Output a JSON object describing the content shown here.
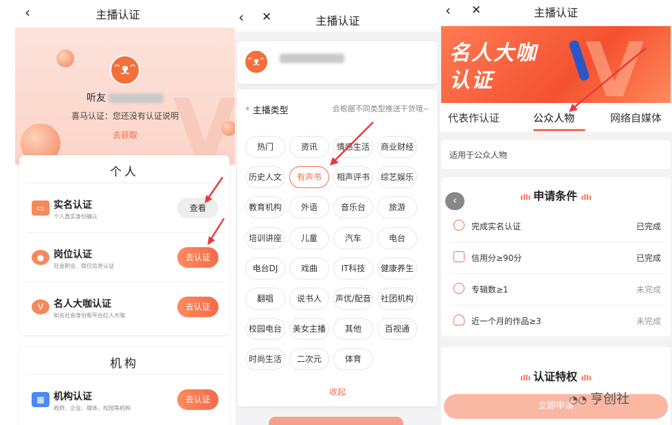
{
  "screen1": {
    "nav": {
      "back": "‹",
      "title": "主播认证"
    },
    "profile": {
      "name": "听友",
      "note": "喜马认证：您还没有认证说明",
      "link": "去获取"
    },
    "personal": {
      "title": "个人",
      "items": [
        {
          "label": "实名认证",
          "sub": "个人真实身份确认",
          "action": "查看"
        },
        {
          "label": "岗位认证",
          "sub": "社会职业、岗位信息认证",
          "action": "去认证"
        },
        {
          "label": "名人大咖认证",
          "sub": "知名社会身份和平台红人大咖",
          "action": "去认证"
        }
      ]
    },
    "org": {
      "title": "机构",
      "items": [
        {
          "label": "机构认证",
          "sub": "政府、企业、媒体、校园等机构",
          "action": "去认证"
        }
      ]
    }
  },
  "screen2": {
    "nav": {
      "back": "‹",
      "close": "✕",
      "title": "主播认证"
    },
    "type_label": "主播类型",
    "required_mark": "*",
    "type_hint": "会根据不同类型推送干货哦~",
    "categories": [
      "热门",
      "资讯",
      "情感生活",
      "商业财经",
      "历史人文",
      "有声书",
      "相声评书",
      "综艺娱乐",
      "教育机构",
      "外语",
      "音乐台",
      "旅游",
      "培训讲座",
      "儿童",
      "汽车",
      "电台",
      "电台DJ",
      "戏曲",
      "IT科技",
      "健康养生",
      "翻唱",
      "说书人",
      "声优/配音",
      "社团机构",
      "校园电台",
      "美女主播",
      "其他",
      "百视通",
      "时尚生活",
      "二次元",
      "体育"
    ],
    "selected": "有声书",
    "collapse": "收起"
  },
  "screen3": {
    "nav": {
      "back": "‹",
      "close": "✕",
      "title": "主播认证"
    },
    "banner": {
      "line1": "名人大咖",
      "line2": "认证"
    },
    "tabs": [
      "代表作认证",
      "公众人物",
      "网络自媒体"
    ],
    "active_tab": "公众人物",
    "applies_to": "适用于公众人物",
    "conditions_title": "申请条件",
    "conditions": [
      {
        "label": "完成实名认证",
        "status": "已完成",
        "icon": "user-icon"
      },
      {
        "label": "信用分≥90分",
        "status": "已完成",
        "icon": "gift-icon"
      },
      {
        "label": "专辑数≥1",
        "status": "未完成",
        "icon": "album-icon"
      },
      {
        "label": "近一个月的作品≥3",
        "status": "未完成",
        "icon": "mic-icon"
      }
    ],
    "privilege_title": "认证特权",
    "apply_button": "立即申请",
    "watermark": "亨创社"
  },
  "colors": {
    "accent": "#f36b4c",
    "arrow": "#e8383d"
  }
}
